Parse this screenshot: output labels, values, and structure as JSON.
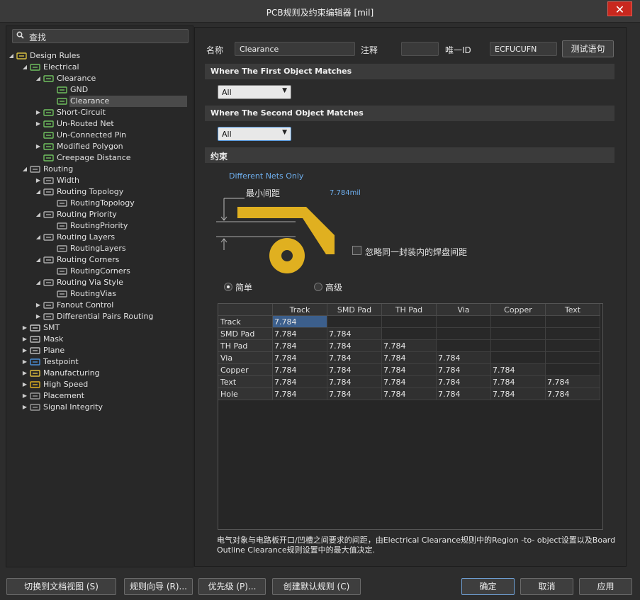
{
  "window": {
    "title": "PCB规则及约束编辑器 [mil]",
    "close_glyph": "✕"
  },
  "search": {
    "placeholder": "查找",
    "icon": "search-icon"
  },
  "tree": [
    {
      "label": "Design Rules",
      "depth": 0,
      "arrow": "◢",
      "icon": "design-rules-icon"
    },
    {
      "label": "Electrical",
      "depth": 1,
      "arrow": "◢",
      "icon": "electrical-rule-icon"
    },
    {
      "label": "Clearance",
      "depth": 2,
      "arrow": "◢",
      "icon": "electrical-rule-icon"
    },
    {
      "label": "GND",
      "depth": 3,
      "arrow": "",
      "icon": "electrical-rule-icon"
    },
    {
      "label": "Clearance",
      "depth": 3,
      "arrow": "",
      "icon": "electrical-rule-icon",
      "selected": true
    },
    {
      "label": "Short-Circuit",
      "depth": 2,
      "arrow": "▶",
      "icon": "electrical-rule-icon"
    },
    {
      "label": "Un-Routed Net",
      "depth": 2,
      "arrow": "▶",
      "icon": "electrical-rule-icon"
    },
    {
      "label": "Un-Connected Pin",
      "depth": 2,
      "arrow": "",
      "icon": "electrical-rule-icon"
    },
    {
      "label": "Modified Polygon",
      "depth": 2,
      "arrow": "▶",
      "icon": "electrical-rule-icon"
    },
    {
      "label": "Creepage Distance",
      "depth": 2,
      "arrow": "",
      "icon": "electrical-rule-icon"
    },
    {
      "label": "Routing",
      "depth": 1,
      "arrow": "◢",
      "icon": "routing-rule-icon"
    },
    {
      "label": "Width",
      "depth": 2,
      "arrow": "▶",
      "icon": "routing-rule-icon"
    },
    {
      "label": "Routing Topology",
      "depth": 2,
      "arrow": "◢",
      "icon": "routing-rule-icon"
    },
    {
      "label": "RoutingTopology",
      "depth": 3,
      "arrow": "",
      "icon": "routing-rule-icon"
    },
    {
      "label": "Routing Priority",
      "depth": 2,
      "arrow": "◢",
      "icon": "routing-rule-icon"
    },
    {
      "label": "RoutingPriority",
      "depth": 3,
      "arrow": "",
      "icon": "routing-rule-icon"
    },
    {
      "label": "Routing Layers",
      "depth": 2,
      "arrow": "◢",
      "icon": "routing-rule-icon"
    },
    {
      "label": "RoutingLayers",
      "depth": 3,
      "arrow": "",
      "icon": "routing-rule-icon"
    },
    {
      "label": "Routing Corners",
      "depth": 2,
      "arrow": "◢",
      "icon": "routing-rule-icon"
    },
    {
      "label": "RoutingCorners",
      "depth": 3,
      "arrow": "",
      "icon": "routing-rule-icon"
    },
    {
      "label": "Routing Via Style",
      "depth": 2,
      "arrow": "◢",
      "icon": "routing-rule-icon"
    },
    {
      "label": "RoutingVias",
      "depth": 3,
      "arrow": "",
      "icon": "routing-rule-icon"
    },
    {
      "label": "Fanout Control",
      "depth": 2,
      "arrow": "▶",
      "icon": "routing-rule-icon"
    },
    {
      "label": "Differential Pairs Routing",
      "depth": 2,
      "arrow": "▶",
      "icon": "routing-rule-icon"
    },
    {
      "label": "SMT",
      "depth": 1,
      "arrow": "▶",
      "icon": "smt-rule-icon"
    },
    {
      "label": "Mask",
      "depth": 1,
      "arrow": "▶",
      "icon": "mask-rule-icon"
    },
    {
      "label": "Plane",
      "depth": 1,
      "arrow": "▶",
      "icon": "plane-rule-icon"
    },
    {
      "label": "Testpoint",
      "depth": 1,
      "arrow": "▶",
      "icon": "testpoint-rule-icon"
    },
    {
      "label": "Manufacturing",
      "depth": 1,
      "arrow": "▶",
      "icon": "manufacturing-rule-icon"
    },
    {
      "label": "High Speed",
      "depth": 1,
      "arrow": "▶",
      "icon": "high-speed-rule-icon"
    },
    {
      "label": "Placement",
      "depth": 1,
      "arrow": "▶",
      "icon": "placement-rule-icon"
    },
    {
      "label": "Signal Integrity",
      "depth": 1,
      "arrow": "▶",
      "icon": "signal-integrity-rule-icon"
    }
  ],
  "rule": {
    "name_label": "名称",
    "name_value": "Clearance",
    "comment_label": "注释",
    "comment_value": "",
    "uid_label": "唯一ID",
    "uid_value": "ECFUCUFN",
    "test_button": "测试语句"
  },
  "first_match": {
    "header": "Where The First Object Matches",
    "value": "All"
  },
  "second_match": {
    "header": "Where The Second Object Matches",
    "value": "All"
  },
  "constraints": {
    "header": "约束",
    "net_scope": "Different Nets Only",
    "min_clearance_label": "最小间距",
    "min_clearance_value": "7.784mil",
    "ignore_pad_label": "忽略同一封装内的焊盘间距",
    "mode_simple": "简单",
    "mode_advanced": "高级"
  },
  "matrix": {
    "columns": [
      "Track",
      "SMD Pad",
      "TH Pad",
      "Via",
      "Copper",
      "Text"
    ],
    "rows": [
      {
        "label": "Track",
        "values": [
          "7.784"
        ]
      },
      {
        "label": "SMD Pad",
        "values": [
          "7.784",
          "7.784"
        ]
      },
      {
        "label": "TH Pad",
        "values": [
          "7.784",
          "7.784",
          "7.784"
        ]
      },
      {
        "label": "Via",
        "values": [
          "7.784",
          "7.784",
          "7.784",
          "7.784"
        ]
      },
      {
        "label": "Copper",
        "values": [
          "7.784",
          "7.784",
          "7.784",
          "7.784",
          "7.784"
        ]
      },
      {
        "label": "Text",
        "values": [
          "7.784",
          "7.784",
          "7.784",
          "7.784",
          "7.784",
          "7.784"
        ]
      },
      {
        "label": "Hole",
        "values": [
          "7.784",
          "7.784",
          "7.784",
          "7.784",
          "7.784",
          "7.784"
        ]
      }
    ]
  },
  "description": "电气对象与电路板开口/凹槽之间要求的间距，由Electrical Clearance规则中的Region -to- object设置以及Board Outline Clearance规则设置中的最大值决定.",
  "footer": {
    "doc_view": "切换到文档视图 (S)",
    "wizard": "规则向导 (R)...",
    "priority": "优先级 (P)...",
    "create_default": "创建默认规则 (C)",
    "ok": "确定",
    "cancel": "取消",
    "apply": "应用"
  },
  "colors": {
    "copper": "#e0b020",
    "accent": "#4a90d9"
  }
}
